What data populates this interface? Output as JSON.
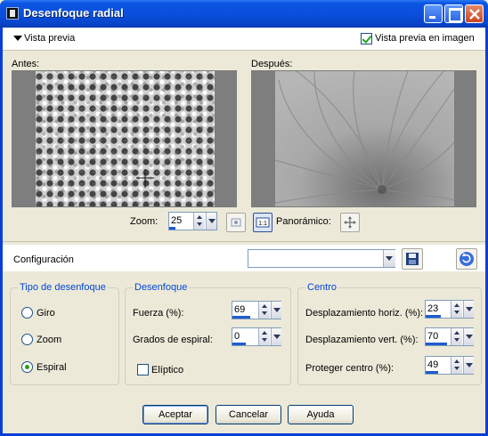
{
  "window": {
    "title": "Desenfoque radial"
  },
  "preview": {
    "toggle_label": "Vista previa",
    "live_checkbox_label": "Vista previa en imagen",
    "live_checked": true,
    "before_label": "Antes:",
    "after_label": "Después:",
    "zoom_label": "Zoom:",
    "zoom_value": "25",
    "zoom_fill": 0.25,
    "panoramic_label": "Panorámico:"
  },
  "config": {
    "label": "Configuración",
    "preset_value": ""
  },
  "blur_type": {
    "title": "Tipo de desenfoque",
    "options": [
      "Giro",
      "Zoom",
      "Espiral"
    ],
    "selected": "Espiral"
  },
  "blur": {
    "title": "Desenfoque",
    "strength_label": "Fuerza (%):",
    "strength_value": "69",
    "strength_fill": 0.69,
    "spiral_label": "Grados de espiral:",
    "spiral_value": "0",
    "spiral_fill": 0.5,
    "elliptic_label": "Elíptico",
    "elliptic_checked": false
  },
  "center": {
    "title": "Centro",
    "hoff_label": "Desplazamiento horiz. (%):",
    "hoff_value": "23",
    "hoff_fill": 0.615,
    "voff_label": "Desplazamiento vert. (%):",
    "voff_value": "70",
    "voff_fill": 0.85,
    "protect_label": "Proteger centro (%):",
    "protect_value": "49",
    "protect_fill": 0.49
  },
  "buttons": {
    "accept": "Aceptar",
    "cancel": "Cancelar",
    "help": "Ayuda"
  },
  "colors": {
    "title_blue": "#0a4fdc",
    "dialog_bg": "#ece9d8",
    "group_title": "#0046d5",
    "fill_bar": "#1f5bcf"
  }
}
